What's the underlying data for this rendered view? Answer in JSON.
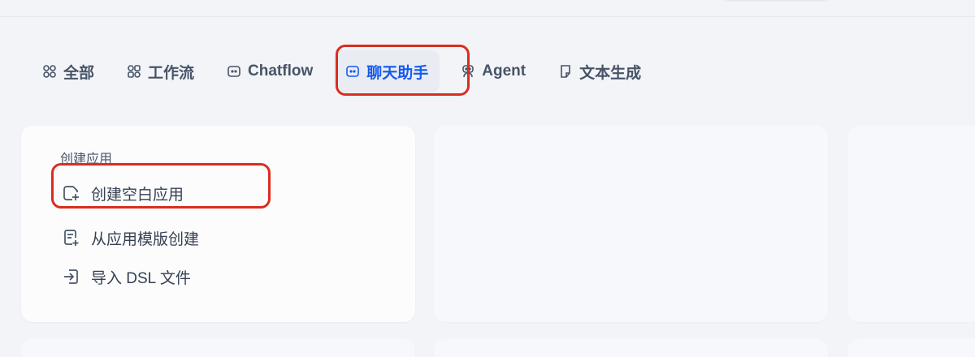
{
  "tabs": [
    {
      "label": "全部",
      "icon": "grid-icon",
      "active": false
    },
    {
      "label": "工作流",
      "icon": "workflow-icon",
      "active": false
    },
    {
      "label": "Chatflow",
      "icon": "chat-bubble-icon",
      "active": false
    },
    {
      "label": "聊天助手",
      "icon": "chat-bubble-icon",
      "active": true
    },
    {
      "label": "Agent",
      "icon": "robot-icon",
      "active": false
    },
    {
      "label": "文本生成",
      "icon": "document-icon",
      "active": false
    }
  ],
  "create": {
    "title": "创建应用",
    "items": [
      {
        "label": "创建空白应用",
        "icon": "new-file-icon"
      },
      {
        "label": "从应用模版创建",
        "icon": "template-file-icon"
      },
      {
        "label": "导入 DSL 文件",
        "icon": "import-icon"
      }
    ]
  },
  "colors": {
    "accent": "#155aef",
    "highlight": "#d92d20",
    "background": "#f2f4f7"
  }
}
